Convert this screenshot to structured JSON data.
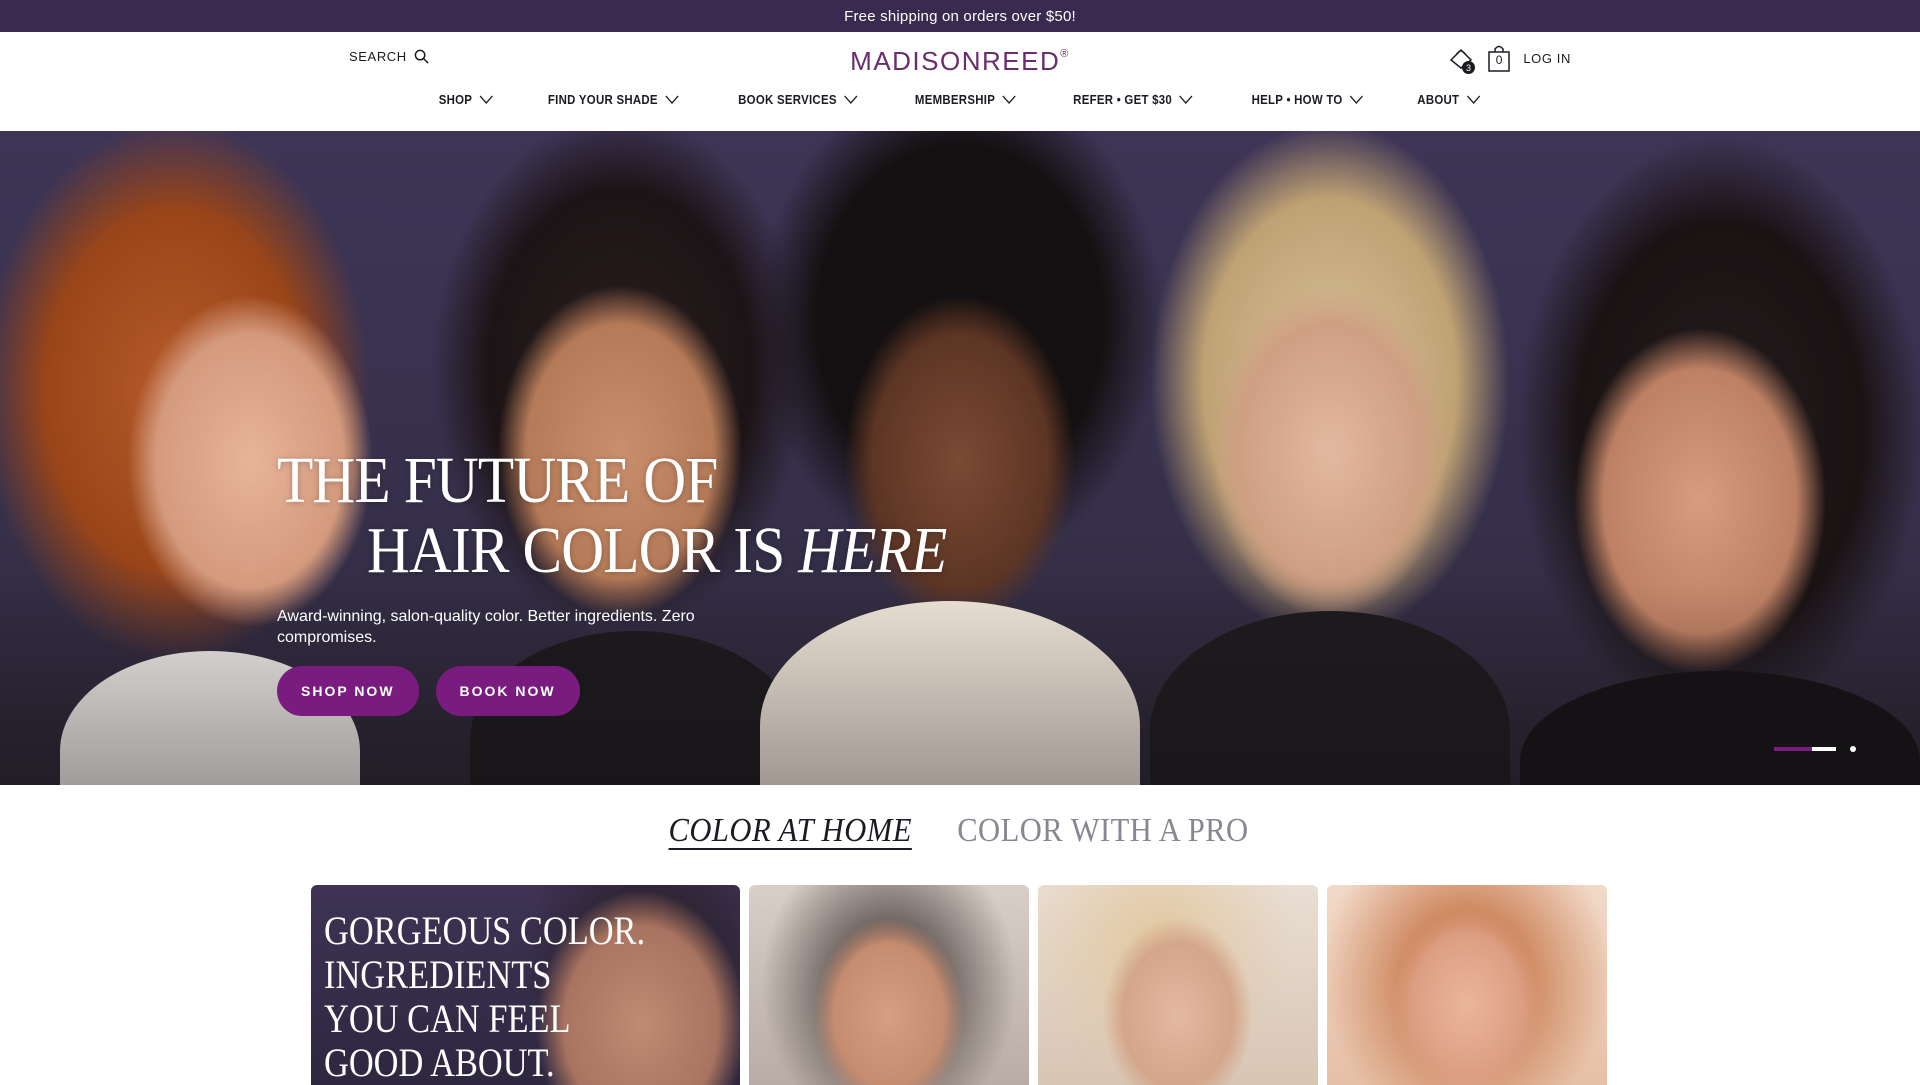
{
  "promo": {
    "text": "Free shipping on orders over $50!"
  },
  "header": {
    "search_label": "SEARCH",
    "logo_text": "MADISONREED",
    "logo_mark": "®",
    "rewards_count": "3",
    "cart_count": "0",
    "login_label": "LOG IN"
  },
  "nav": {
    "items": [
      {
        "label": "SHOP"
      },
      {
        "label": "FIND YOUR SHADE"
      },
      {
        "label": "BOOK SERVICES"
      },
      {
        "label": "MEMBERSHIP"
      },
      {
        "label": "REFER • GET $30"
      },
      {
        "label": "HELP • HOW TO"
      },
      {
        "label": "ABOUT"
      }
    ]
  },
  "hero": {
    "headline_line1": "THE FUTURE OF",
    "headline_line2": "HAIR COLOR IS",
    "headline_emphasis": "HERE",
    "subtext": "Award-winning, salon-quality color. Better ingredients. Zero compromises.",
    "cta_shop": "SHOP NOW",
    "cta_book": "BOOK NOW",
    "slides_count": 2,
    "active_slide": 1
  },
  "tabs": [
    {
      "label": "COLOR AT HOME",
      "active": true
    },
    {
      "label": "COLOR WITH A PRO",
      "active": false
    }
  ],
  "cards": {
    "feature_title": "GORGEOUS COLOR.\nINGREDIENTS\nYOU CAN FEEL\nGOOD ABOUT."
  },
  "colors": {
    "promo_bg": "#3a2a4f",
    "brand_purple": "#6b2c6e",
    "cta_purple": "#7a1b7f"
  },
  "icons": [
    "search-icon",
    "rewards-icon",
    "cart-icon",
    "chevron-down-icon"
  ]
}
